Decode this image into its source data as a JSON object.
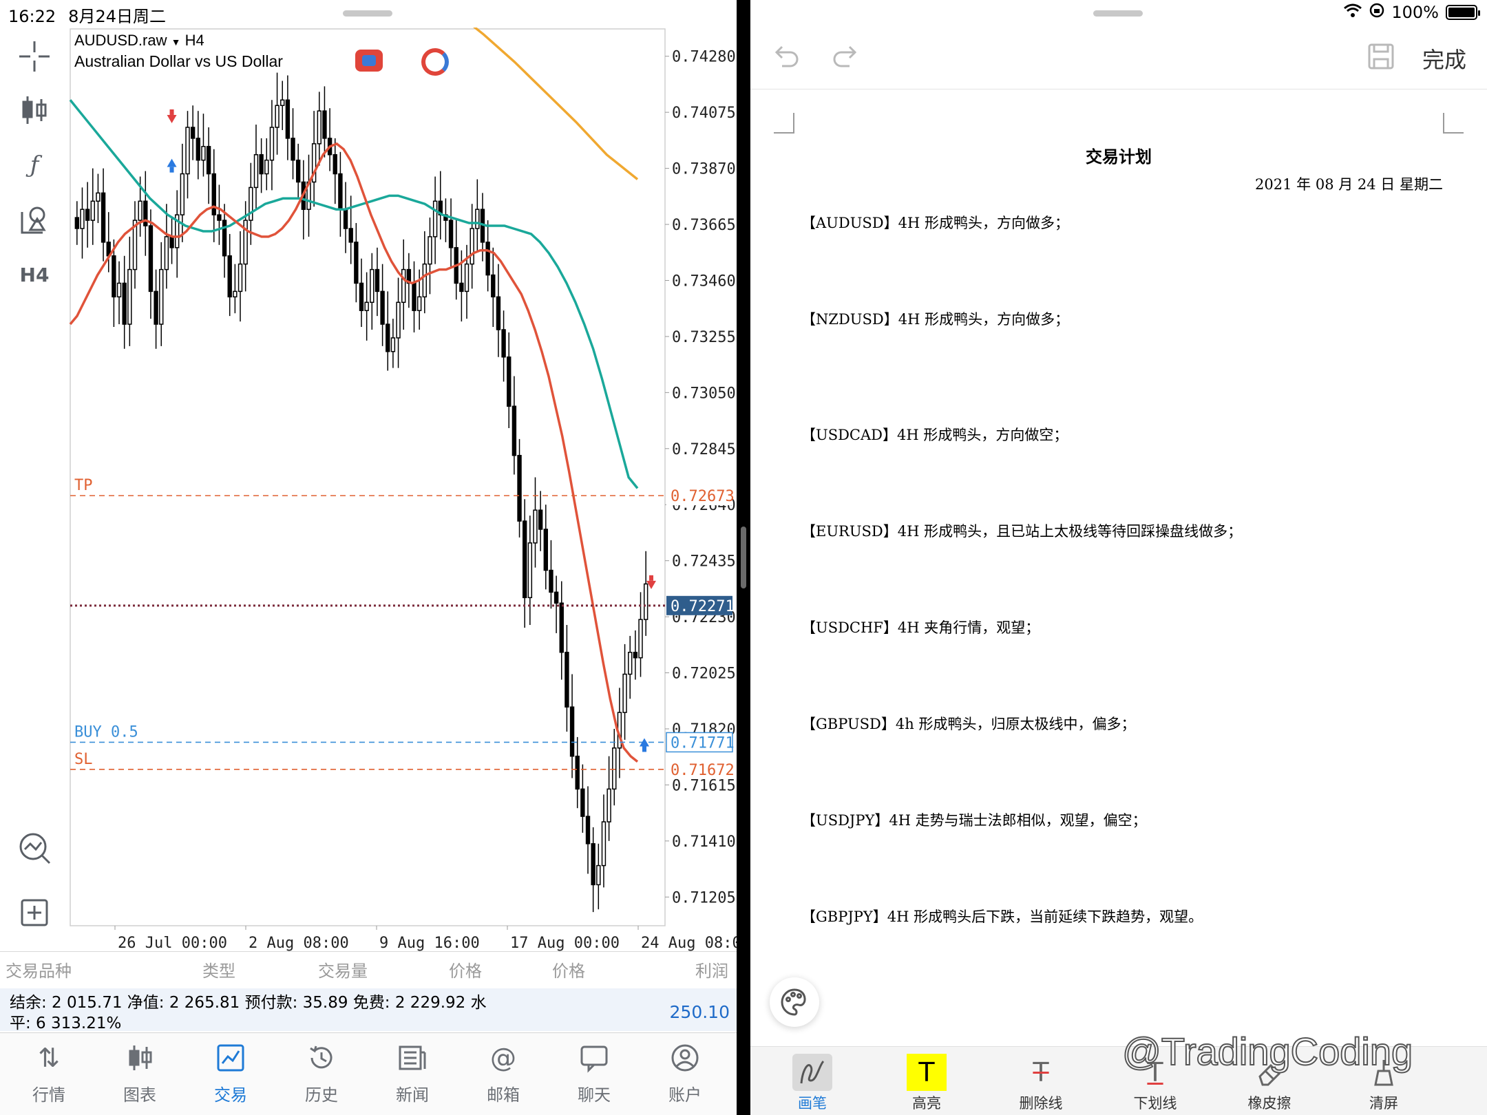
{
  "status_left": {
    "time": "16:22",
    "date": "8月24日周二"
  },
  "status_right": {
    "battery": "100%"
  },
  "chart_header": {
    "symbol": "AUDUSD.raw",
    "timeframe": "H4",
    "description": "Australian Dollar vs US Dollar"
  },
  "left_tools": {
    "timeframe_label": "H4"
  },
  "colors": {
    "bull": "#000000",
    "bear": "#000000",
    "ma_fast": "#e0533a",
    "ma_mid": "#1aa89a",
    "ma_slow": "#f0a830",
    "tp": "#e06030",
    "buy": "#3a8fd8",
    "sl": "#e06030",
    "price_line": "#7a2a3a",
    "price_tag_bg": "#2f5d8c"
  },
  "chart_data": {
    "type": "candlestick",
    "ylim": [
      0.711,
      0.7438
    ],
    "y_ticks": [
      "0.74280",
      "0.74075",
      "0.73870",
      "0.73665",
      "0.73460",
      "0.73255",
      "0.73050",
      "0.72845",
      "0.72640",
      "0.72435",
      "0.72230",
      "0.72025",
      "0.71820",
      "0.71615",
      "0.71410",
      "0.71205"
    ],
    "x_ticks": [
      "26 Jul 00:00",
      "2 Aug 08:00",
      "9 Aug 16:00",
      "17 Aug 00:00",
      "24 Aug 08:00"
    ],
    "closes": [
      0.7365,
      0.7372,
      0.7368,
      0.7375,
      0.7378,
      0.736,
      0.7355,
      0.734,
      0.7345,
      0.733,
      0.735,
      0.7368,
      0.7375,
      0.7366,
      0.7342,
      0.733,
      0.735,
      0.7362,
      0.7358,
      0.737,
      0.7385,
      0.7402,
      0.7398,
      0.739,
      0.7395,
      0.7385,
      0.737,
      0.7368,
      0.7355,
      0.734,
      0.7342,
      0.7352,
      0.7368,
      0.738,
      0.7392,
      0.7385,
      0.739,
      0.7402,
      0.741,
      0.7412,
      0.7398,
      0.739,
      0.7382,
      0.7372,
      0.7382,
      0.7396,
      0.7408,
      0.7398,
      0.7392,
      0.7385,
      0.7372,
      0.7365,
      0.736,
      0.7345,
      0.7335,
      0.7338,
      0.735,
      0.7342,
      0.733,
      0.732,
      0.7325,
      0.7338,
      0.735,
      0.7345,
      0.7335,
      0.734,
      0.7352,
      0.7362,
      0.7375,
      0.737,
      0.7368,
      0.7358,
      0.7345,
      0.7342,
      0.7352,
      0.7365,
      0.7372,
      0.736,
      0.7348,
      0.734,
      0.7328,
      0.7318,
      0.73,
      0.7282,
      0.7258,
      0.723,
      0.725,
      0.7262,
      0.7255,
      0.724,
      0.7232,
      0.7228,
      0.721,
      0.719,
      0.7172,
      0.716,
      0.715,
      0.714,
      0.7125,
      0.7132,
      0.7148,
      0.716,
      0.7175,
      0.7188,
      0.7202,
      0.721,
      0.7208,
      0.7222,
      0.7235
    ],
    "ma_fast": [
      0.733,
      0.7333,
      0.7338,
      0.7343,
      0.7348,
      0.7352,
      0.7356,
      0.736,
      0.7363,
      0.7365,
      0.7367,
      0.7368,
      0.7367,
      0.7365,
      0.7363,
      0.7362,
      0.7362,
      0.7364,
      0.7367,
      0.737,
      0.7372,
      0.7373,
      0.7372,
      0.737,
      0.7368,
      0.7366,
      0.7364,
      0.7363,
      0.7362,
      0.7362,
      0.7363,
      0.7365,
      0.7368,
      0.7372,
      0.7377,
      0.7382,
      0.7387,
      0.7392,
      0.7395,
      0.7396,
      0.7394,
      0.739,
      0.7384,
      0.7377,
      0.737,
      0.7364,
      0.7358,
      0.7353,
      0.7349,
      0.7346,
      0.7345,
      0.7346,
      0.7348,
      0.7349,
      0.735,
      0.735,
      0.7351,
      0.7352,
      0.7354,
      0.7356,
      0.7357,
      0.7357,
      0.7356,
      0.7353,
      0.7349,
      0.7345,
      0.7341,
      0.7335,
      0.7328,
      0.732,
      0.7311,
      0.73,
      0.7289,
      0.7276,
      0.7262,
      0.7248,
      0.7234,
      0.722,
      0.7206,
      0.7193,
      0.7182,
      0.7175,
      0.7172,
      0.717
    ],
    "ma_mid": [
      0.7412,
      0.7408,
      0.7404,
      0.74,
      0.7396,
      0.7392,
      0.7388,
      0.7384,
      0.738,
      0.7376,
      0.7373,
      0.737,
      0.7368,
      0.7366,
      0.7365,
      0.7364,
      0.7364,
      0.7365,
      0.7366,
      0.7368,
      0.737,
      0.7372,
      0.7374,
      0.7375,
      0.7376,
      0.7376,
      0.7376,
      0.7375,
      0.7374,
      0.7373,
      0.7372,
      0.7372,
      0.7373,
      0.7374,
      0.7375,
      0.7376,
      0.7377,
      0.7377,
      0.7376,
      0.7375,
      0.7374,
      0.7372,
      0.737,
      0.7369,
      0.7368,
      0.7367,
      0.7367,
      0.7366,
      0.7366,
      0.7366,
      0.7365,
      0.7364,
      0.7363,
      0.736,
      0.7356,
      0.7351,
      0.7345,
      0.7338,
      0.733,
      0.7321,
      0.731,
      0.7298,
      0.7286,
      0.7274,
      0.727
    ],
    "ma_slow": [
      0.7452,
      0.7445,
      0.7436,
      0.7426,
      0.7415,
      0.7404,
      0.7392,
      0.7383
    ],
    "levels": {
      "tp": 0.72673,
      "current": 0.72271,
      "buy": 0.71771,
      "sl": 0.71672
    },
    "level_labels": {
      "tp": "TP",
      "buy": "BUY 0.5",
      "sl": "SL"
    },
    "level_values": {
      "tp": "0.72673",
      "current": "0.72271",
      "buy": "0.71771",
      "sl": "0.71672"
    }
  },
  "table_head": [
    "交易品种",
    "类型",
    "交易量",
    "价格",
    "价格",
    "利润"
  ],
  "balance": {
    "line1": "结余:  2 015.71 净值:  2 265.81 预付款:  35.89 免费:  2 229.92 水",
    "line2": "平:  6 313.21%",
    "pnl": "250.10"
  },
  "tabs": [
    {
      "label": "行情"
    },
    {
      "label": "图表"
    },
    {
      "label": "交易"
    },
    {
      "label": "历史"
    },
    {
      "label": "新闻"
    },
    {
      "label": "邮箱"
    },
    {
      "label": "聊天"
    },
    {
      "label": "账户"
    }
  ],
  "note_toolbar": {
    "done": "完成"
  },
  "doc": {
    "title": "交易计划",
    "date": "2021 年 08 月 24 日   星期二",
    "lines": [
      "【AUDUSD】4H 形成鸭头，方向做多；",
      "【NZDUSD】4H 形成鸭头，方向做多；",
      "【USDCAD】4H 形成鸭头，方向做空；",
      "【EURUSD】4H 形成鸭头，且已站上太极线等待回踩操盘线做多；",
      "【USDCHF】4H 夹角行情，观望；",
      "【GBPUSD】4h 形成鸭头，归原太极线中，偏多；",
      "【USDJPY】4H 走势与瑞士法郎相似，观望，偏空；",
      "【GBPJPY】4H 形成鸭头后下跌，当前延续下跌趋势，观望。"
    ]
  },
  "draw_tools": [
    {
      "label": "画笔"
    },
    {
      "label": "高亮"
    },
    {
      "label": "删除线"
    },
    {
      "label": "下划线"
    },
    {
      "label": "橡皮擦"
    },
    {
      "label": "清屏"
    }
  ],
  "watermark": "@TradingCoding"
}
